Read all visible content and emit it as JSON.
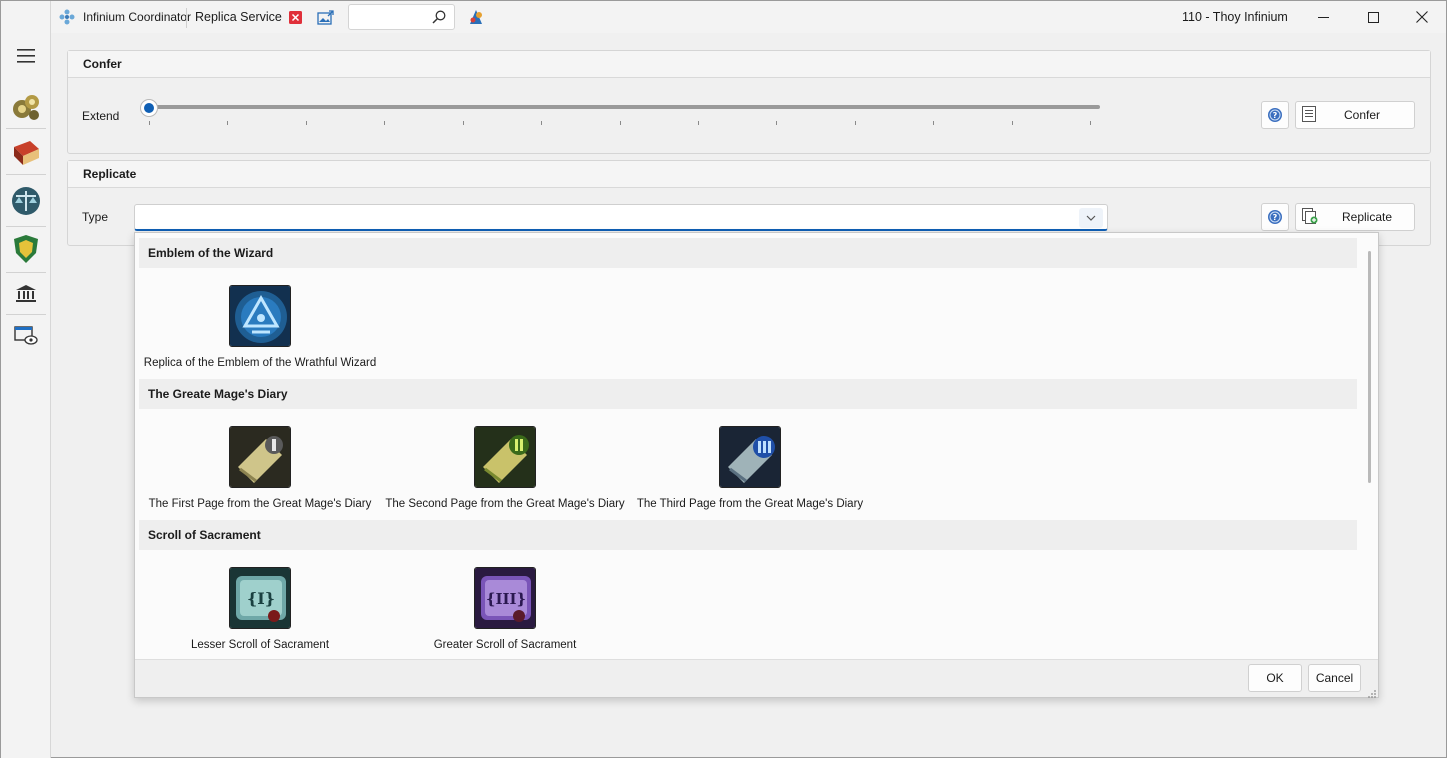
{
  "app": {
    "name": "Infinium Coordinator",
    "active_tab": "Replica Service",
    "window_title": "110 - Thoy Infinium",
    "search": {
      "value": "",
      "placeholder": ""
    }
  },
  "sidebar": {
    "items": [
      {
        "name": "menu-icon"
      },
      {
        "name": "gears-icon"
      },
      {
        "name": "book-icon"
      },
      {
        "name": "scales-icon"
      },
      {
        "name": "shield-icon"
      },
      {
        "name": "bank-icon"
      },
      {
        "name": "window-eye-icon"
      }
    ]
  },
  "confer": {
    "title": "Confer",
    "extend_label": "Extend",
    "slider_value": 0,
    "tick_count": 13,
    "button_label": "Confer"
  },
  "replicate": {
    "title": "Replicate",
    "type_label": "Type",
    "type_value": "",
    "button_label": "Replicate"
  },
  "dropdown": {
    "sections": [
      {
        "title": "Emblem of the Wizard",
        "items": [
          {
            "label": "Replica of the Emblem of the Wrathful Wizard",
            "icon": "emblem-icon"
          }
        ]
      },
      {
        "title": "The Greate Mage's Diary",
        "items": [
          {
            "label": "The First Page from the Great Mage's Diary",
            "icon": "scroll-i-icon"
          },
          {
            "label": "The Second Page from the Great Mage's Diary",
            "icon": "scroll-ii-icon"
          },
          {
            "label": "The Third Page from the Great Mage's Diary",
            "icon": "scroll-iii-icon"
          }
        ]
      },
      {
        "title": "Scroll of Sacrament",
        "items": [
          {
            "label": "Lesser Scroll of Sacrament",
            "icon": "lesser-scroll-icon"
          },
          {
            "label": "Greater Scroll of Sacrament",
            "icon": "greater-scroll-icon"
          }
        ]
      }
    ],
    "ok_label": "OK",
    "cancel_label": "Cancel"
  },
  "colors": {
    "accent": "#0f5fb4",
    "close_tab": "#e0303a"
  }
}
